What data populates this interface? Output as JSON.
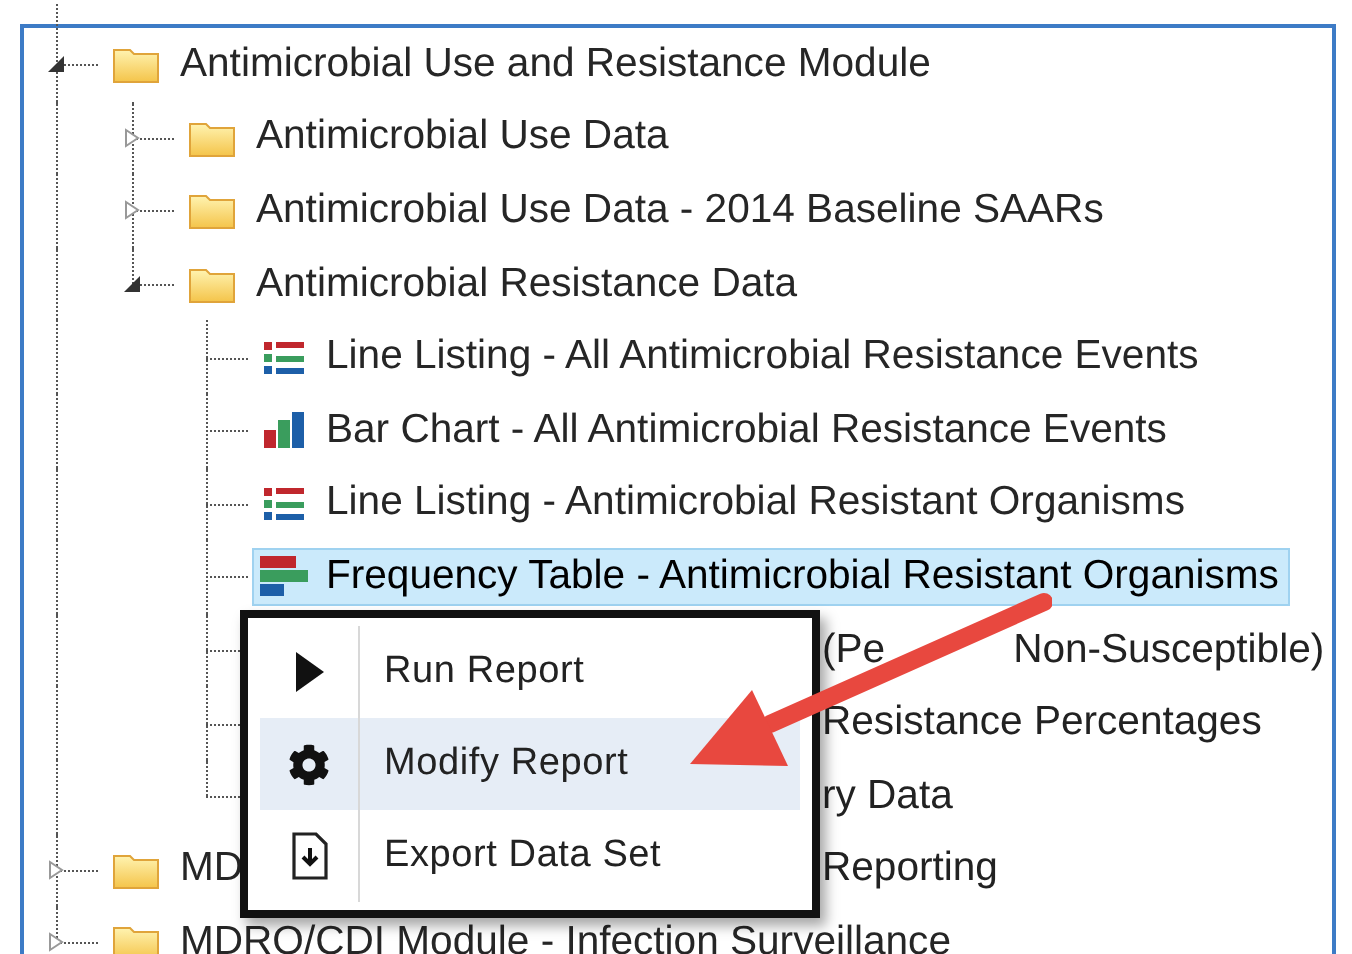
{
  "tree": [
    {
      "kind": "folder",
      "label": "Antimicrobial Use and Resistance Module",
      "expanded": true,
      "selected": false,
      "children": [
        {
          "kind": "folder",
          "label": "Antimicrobial Use Data",
          "expanded": false,
          "selected": false
        },
        {
          "kind": "folder",
          "label": "Antimicrobial Use Data - 2014 Baseline SAARs",
          "expanded": false,
          "selected": false
        },
        {
          "kind": "folder",
          "label": "Antimicrobial Resistance Data",
          "expanded": true,
          "selected": false,
          "children": [
            {
              "kind": "line_listing",
              "label": "Line Listing - All Antimicrobial Resistance Events",
              "selected": false
            },
            {
              "kind": "bar_chart",
              "label": "Bar Chart - All Antimicrobial Resistance Events",
              "selected": false
            },
            {
              "kind": "line_listing",
              "label": "Line Listing - Antimicrobial Resistant Organisms",
              "selected": false
            },
            {
              "kind": "frequency_table",
              "label": "Frequency Table - Antimicrobial Resistant Organisms",
              "selected": true
            },
            {
              "kind": "covered",
              "tail": "(Pe",
              "tail_after_arrow": "Non-Susceptible)"
            },
            {
              "kind": "covered",
              "tail": "Resistance Percentages"
            },
            {
              "kind": "covered",
              "tail": "ry Data"
            }
          ]
        }
      ]
    },
    {
      "kind": "folder",
      "label": "MD",
      "tail": "Reporting",
      "expanded": false,
      "selected": false
    },
    {
      "kind": "folder",
      "label": "MDRO/CDI Module - Infection Surveillance",
      "expanded": false,
      "selected": false
    }
  ],
  "context_menu": [
    {
      "kind": "run",
      "label": "Run Report",
      "selected": false
    },
    {
      "kind": "modify",
      "label": "Modify Report",
      "selected": true
    },
    {
      "kind": "export",
      "label": "Export Data Set",
      "selected": false
    }
  ]
}
